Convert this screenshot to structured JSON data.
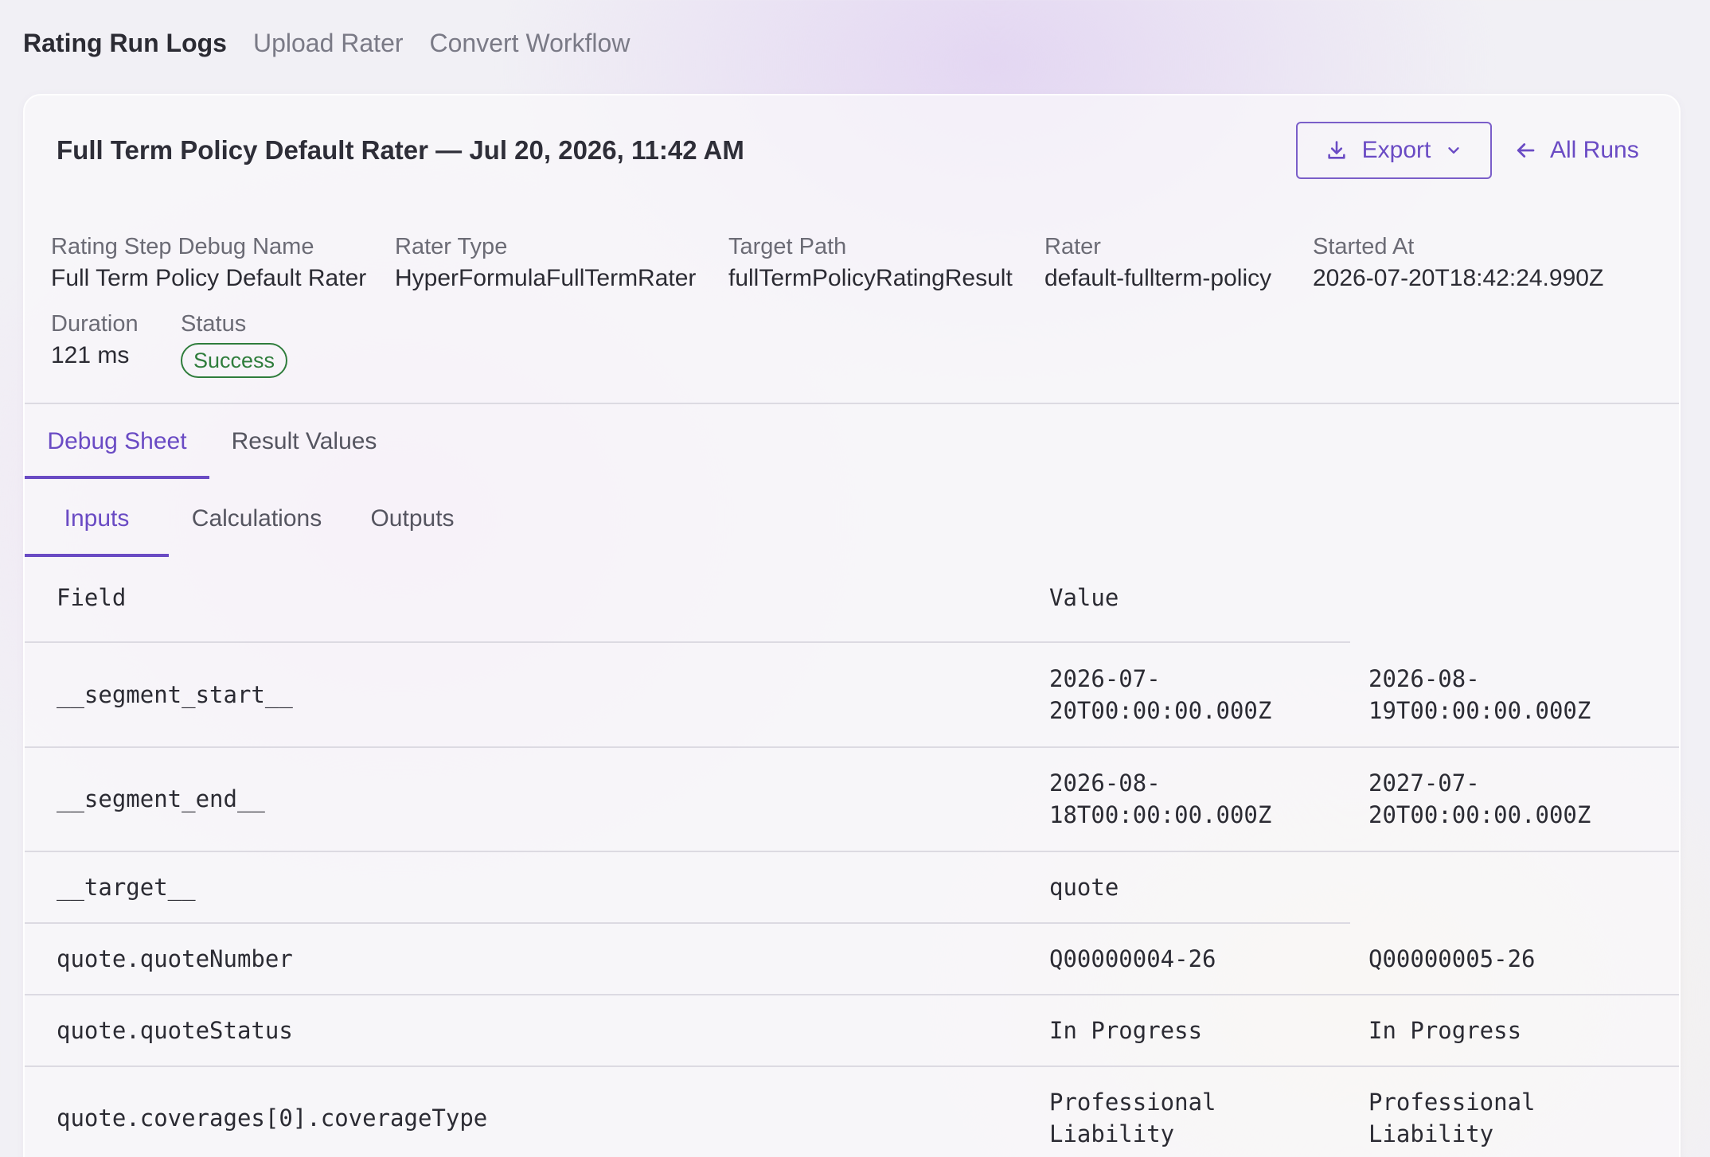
{
  "nav": {
    "items": [
      "Rating Run Logs",
      "Upload Rater",
      "Convert Workflow"
    ]
  },
  "header": {
    "title": "Full Term Policy Default Rater — Jul 20, 2026, 11:42 AM",
    "export_label": "Export",
    "all_runs_label": "All Runs"
  },
  "meta": {
    "step_name_label": "Rating Step Debug Name",
    "step_name_value": "Full Term Policy Default Rater",
    "rater_type_label": "Rater Type",
    "rater_type_value": "HyperFormulaFullTermRater",
    "target_path_label": "Target Path",
    "target_path_value": "fullTermPolicyRatingResult",
    "rater_label": "Rater",
    "rater_value": "default-fullterm-policy",
    "started_at_label": "Started At",
    "started_at_value": "2026-07-20T18:42:24.990Z",
    "duration_label": "Duration",
    "duration_value": "121 ms",
    "status_label": "Status",
    "status_value": "Success"
  },
  "tabs": [
    "Debug Sheet",
    "Result Values"
  ],
  "subtabs": [
    "Inputs",
    "Calculations",
    "Outputs"
  ],
  "table": {
    "headers": [
      "Field",
      "Value"
    ],
    "rows": [
      {
        "field": "__segment_start__",
        "v1": "2026-07-\n20T00:00:00.000Z",
        "v2": "2026-08-\n19T00:00:00.000Z"
      },
      {
        "field": "__segment_end__",
        "v1": "2026-08-\n18T00:00:00.000Z",
        "v2": "2027-07-\n20T00:00:00.000Z"
      },
      {
        "field": "__target__",
        "v1": "quote",
        "v2": ""
      },
      {
        "field": "quote.quoteNumber",
        "v1": "Q00000004-26",
        "v2": "Q00000005-26"
      },
      {
        "field": "quote.quoteStatus",
        "v1": "In Progress",
        "v2": "In Progress"
      },
      {
        "field": "quote.coverages[0].coverageType",
        "v1": "Professional\nLiability",
        "v2": "Professional\nLiability"
      }
    ]
  },
  "colors": {
    "accent": "#6a4bc4",
    "success": "#2f7d3c"
  }
}
